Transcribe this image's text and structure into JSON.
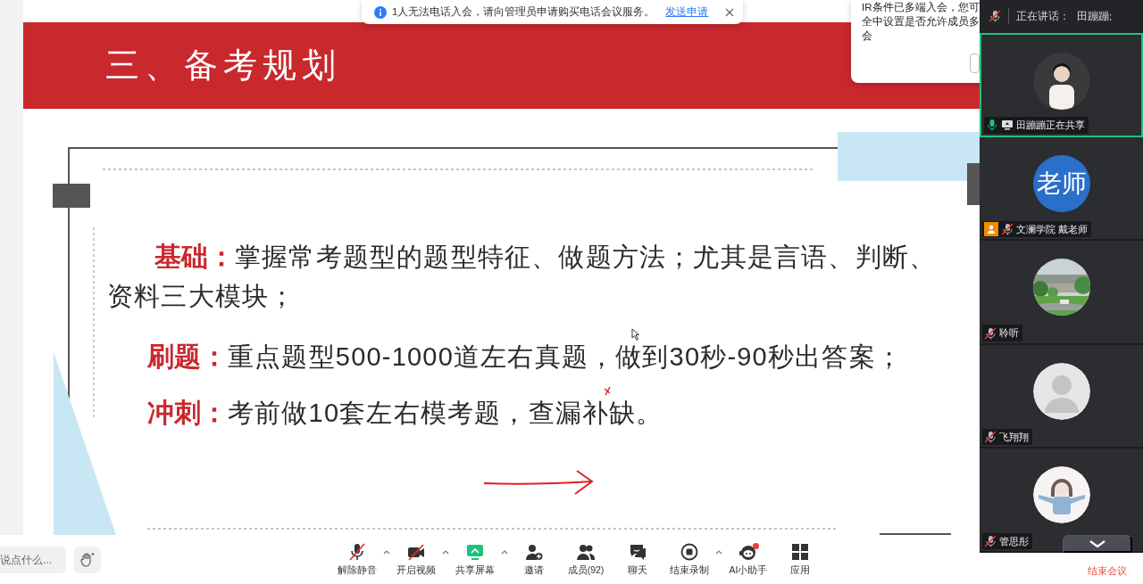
{
  "notification": {
    "message": "1人无法电话入会，请向管理员申请购买电话会议服务。",
    "link": "发送申请"
  },
  "popup": {
    "lines": [
      "IR条件已多端入会，您可",
      "全中设置是否允许成员多",
      "会"
    ]
  },
  "slide": {
    "title": "三、备考规划",
    "points": [
      {
        "label": "基础：",
        "text": "掌握常考题型的题型特征、做题方法；尤其是言语、判断、资料三大模块；"
      },
      {
        "label": "刷题：",
        "text": "重点题型500-1000道左右真题，做到30秒-90秒出答案；"
      },
      {
        "label": "冲刺：",
        "text": "考前做10套左右模考题，查漏补缺。"
      }
    ]
  },
  "speaking_bar": {
    "label": "正在讲话：",
    "names": "田蹦蹦;",
    "muted": true
  },
  "participants": [
    {
      "kind": "person",
      "name": "田蹦蹦正在共享",
      "muted": false,
      "active_speaker": true,
      "host": false,
      "sharing": true
    },
    {
      "kind": "initials",
      "initials": "老师",
      "name": "文澜学院 戴老师",
      "muted": true,
      "active_speaker": false,
      "host": true,
      "sharing": false
    },
    {
      "kind": "picture",
      "name": "聆听",
      "muted": true,
      "active_speaker": false,
      "host": false,
      "sharing": false
    },
    {
      "kind": "default",
      "name": "飞翔翔",
      "muted": true,
      "active_speaker": false,
      "host": false,
      "sharing": false
    },
    {
      "kind": "cartoon",
      "name": "管思彤",
      "muted": true,
      "active_speaker": false,
      "host": false,
      "sharing": false
    }
  ],
  "chat_input": {
    "placeholder": "说点什么..."
  },
  "buttons": [
    {
      "kind": "mic",
      "label": "解除静音",
      "has_menu": true,
      "notified": false
    },
    {
      "kind": "video",
      "label": "开启视频",
      "has_menu": true,
      "notified": false
    },
    {
      "kind": "share",
      "label": "共享屏幕",
      "has_menu": true,
      "notified": false
    },
    {
      "kind": "invite",
      "label": "邀请",
      "has_menu": false,
      "notified": false
    },
    {
      "kind": "members",
      "label": "成员(92)",
      "has_menu": false,
      "notified": false
    },
    {
      "kind": "chat",
      "label": "聊天",
      "has_menu": false,
      "notified": false
    },
    {
      "kind": "record",
      "label": "结束录制",
      "has_menu": true,
      "notified": false
    },
    {
      "kind": "assistant",
      "label": "AI小助手",
      "has_menu": false,
      "notified": true
    },
    {
      "kind": "apps",
      "label": "应用",
      "has_menu": false,
      "notified": false
    }
  ],
  "end_button": {
    "label": "结束会议"
  }
}
